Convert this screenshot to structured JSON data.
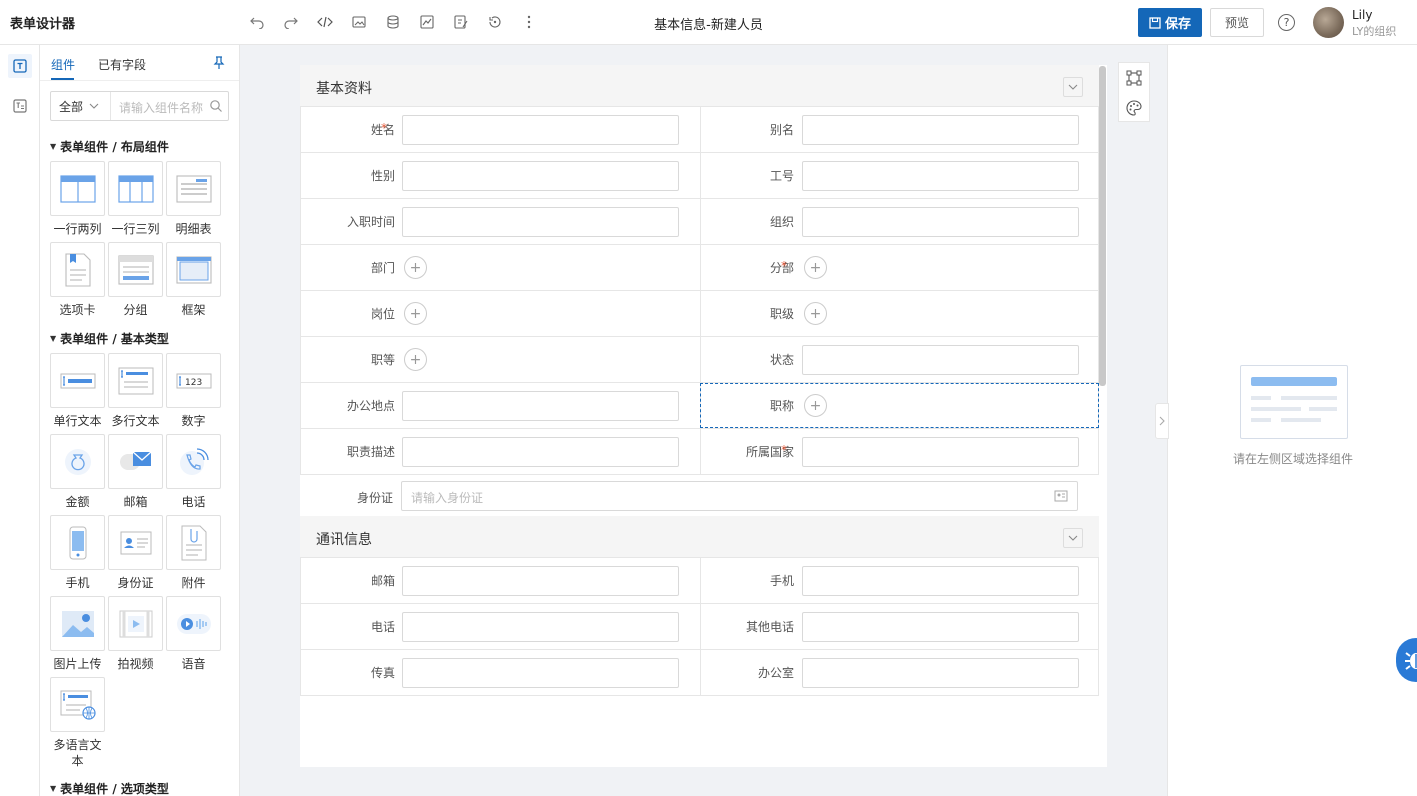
{
  "app": {
    "title": "表单设计器",
    "doc_title": "基本信息-新建人员"
  },
  "header": {
    "save_label": "保存",
    "preview_label": "预览",
    "help": "?",
    "user_name": "Lily",
    "user_org": "LY的组织"
  },
  "toolbar": {
    "icons": [
      "undo-icon",
      "redo-icon",
      "code-icon",
      "image-icon",
      "database-icon",
      "chart-icon",
      "edit-icon",
      "history-icon",
      "more-icon"
    ]
  },
  "panel": {
    "tabs": [
      "组件",
      "已有字段"
    ],
    "filter": {
      "selected": "全部",
      "placeholder": "请输入组件名称"
    },
    "sections": [
      {
        "title": "表单组件 / 布局组件",
        "items": [
          "一行两列",
          "一行三列",
          "明细表",
          "选项卡",
          "分组",
          "框架"
        ]
      },
      {
        "title": "表单组件 / 基本类型",
        "items": [
          "单行文本",
          "多行文本",
          "数字",
          "金额",
          "邮箱",
          "电话",
          "手机",
          "身份证",
          "附件",
          "图片上传",
          "拍视频",
          "语音",
          "多语言文本"
        ]
      },
      {
        "title": "表单组件 / 选项类型",
        "items": []
      }
    ]
  },
  "form": {
    "groups": [
      {
        "title": "基本资料",
        "rows": [
          [
            {
              "label": "姓名",
              "required": true,
              "type": "input"
            },
            {
              "label": "别名",
              "required": false,
              "type": "input"
            }
          ],
          [
            {
              "label": "性别",
              "required": false,
              "type": "input"
            },
            {
              "label": "工号",
              "required": false,
              "type": "input"
            }
          ],
          [
            {
              "label": "入职时间",
              "required": false,
              "type": "input"
            },
            {
              "label": "组织",
              "required": false,
              "type": "input"
            }
          ],
          [
            {
              "label": "部门",
              "required": false,
              "type": "plus"
            },
            {
              "label": "分部",
              "required": true,
              "type": "plus"
            }
          ],
          [
            {
              "label": "岗位",
              "required": false,
              "type": "plus"
            },
            {
              "label": "职级",
              "required": false,
              "type": "plus"
            }
          ],
          [
            {
              "label": "职等",
              "required": false,
              "type": "plus"
            },
            {
              "label": "状态",
              "required": false,
              "type": "input"
            }
          ],
          [
            {
              "label": "办公地点",
              "required": false,
              "type": "input"
            },
            {
              "label": "职称",
              "required": false,
              "type": "plus",
              "selected": true
            }
          ],
          [
            {
              "label": "职责描述",
              "required": false,
              "type": "input"
            },
            {
              "label": "所属国家",
              "required": true,
              "type": "input"
            }
          ]
        ],
        "full_row": {
          "label": "身份证",
          "placeholder": "请输入身份证"
        }
      },
      {
        "title": "通讯信息",
        "rows": [
          [
            {
              "label": "邮箱",
              "type": "input"
            },
            {
              "label": "手机",
              "type": "input"
            }
          ],
          [
            {
              "label": "电话",
              "type": "input"
            },
            {
              "label": "其他电话",
              "type": "input"
            }
          ],
          [
            {
              "label": "传真",
              "type": "input"
            },
            {
              "label": "办公室",
              "type": "input"
            }
          ]
        ]
      }
    ]
  },
  "right_panel": {
    "empty_text": "请在左侧区域选择组件"
  },
  "colors": {
    "primary": "#1467b8",
    "required": "#e65c3c",
    "border": "#e6e6e6"
  }
}
